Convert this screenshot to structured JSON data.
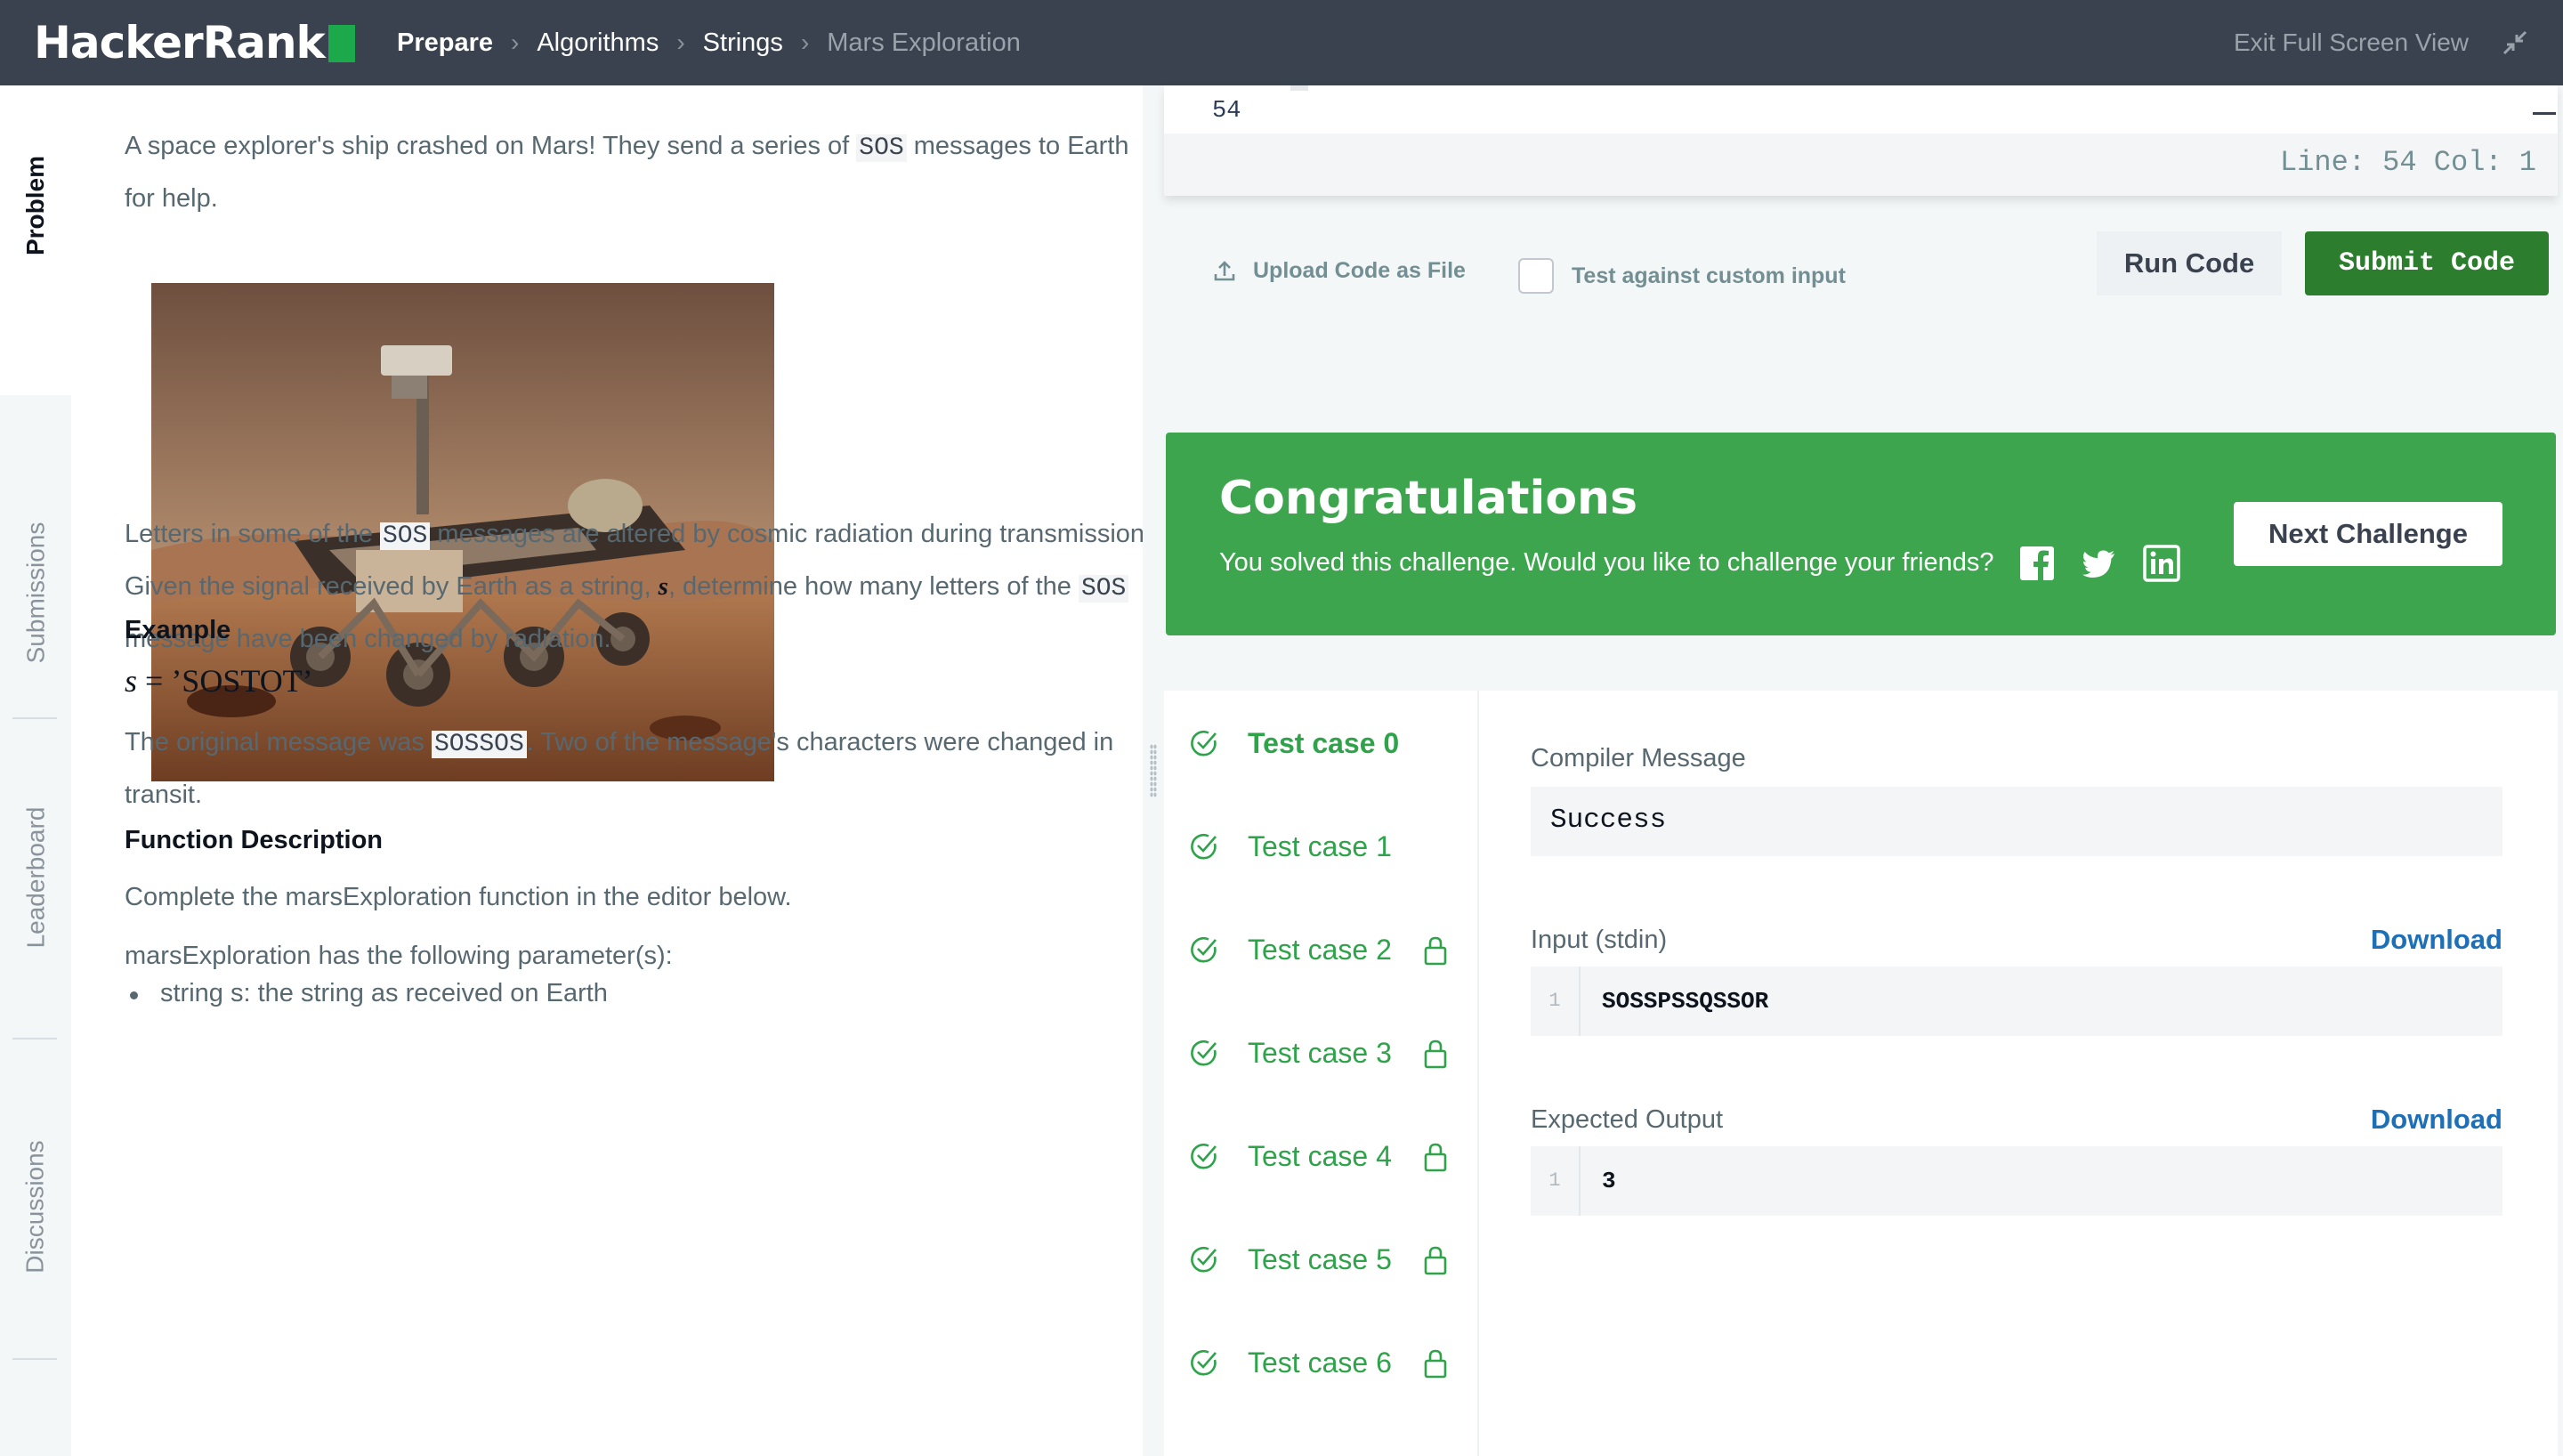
{
  "brand": {
    "name": "HackerRank",
    "accent": "#1ba94c"
  },
  "breadcrumbs": [
    "Prepare",
    "Algorithms",
    "Strings",
    "Mars Exploration"
  ],
  "header": {
    "exit_label": "Exit Full Screen View",
    "exit_icon": "shrink-arrows-icon"
  },
  "side_tabs": [
    {
      "label": "Problem",
      "active": true
    },
    {
      "label": "Submissions",
      "active": false
    },
    {
      "label": "Leaderboard",
      "active": false
    },
    {
      "label": "Discussions",
      "active": false
    }
  ],
  "problem": {
    "intro_before": "A space explorer's ship crashed on Mars! They send a series of ",
    "intro_code": "SOS",
    "intro_after": " messages to Earth for help.",
    "para2_before": "Letters in some of the ",
    "para2_code": "SOS",
    "para2_mid": " messages are altered by cosmic radiation during transmission. Given the signal received by Earth as a string, ",
    "para2_var": "s",
    "para2_mid2": ", determine how many letters of the ",
    "para2_code2": "SOS",
    "para2_after": " message have been changed by radiation.",
    "example_heading": "Example",
    "example_var": "s",
    "example_eq": " = ’SOSTOT’",
    "example_text_before": "The original message was ",
    "example_code": "SOSSOS",
    "example_text_after": ". Two of the message's characters were changed in transit.",
    "function_heading": "Function Description",
    "function_text": "Complete the marsExploration function in the editor below.",
    "params_text": "marsExploration has the following parameter(s):",
    "param_bullet": "string s: the string as received on Earth"
  },
  "editor": {
    "line_number": "54",
    "status": "Line: 54 Col: 1"
  },
  "actions": {
    "upload_label": "Upload Code as File",
    "custom_input_label": "Test against custom input",
    "custom_input_checked": false,
    "run_label": "Run Code",
    "submit_label": "Submit Code"
  },
  "congrats": {
    "title": "Congratulations",
    "subtitle": "You solved this challenge. Would you like to challenge your friends?",
    "social_icons": [
      "facebook-icon",
      "twitter-icon",
      "linkedin-icon"
    ],
    "next_label": "Next Challenge",
    "color": "#3da54e"
  },
  "test_cases": [
    {
      "label": "Test case 0",
      "locked": false,
      "active": true
    },
    {
      "label": "Test case 1",
      "locked": false,
      "active": false
    },
    {
      "label": "Test case 2",
      "locked": true,
      "active": false
    },
    {
      "label": "Test case 3",
      "locked": true,
      "active": false
    },
    {
      "label": "Test case 4",
      "locked": true,
      "active": false
    },
    {
      "label": "Test case 5",
      "locked": true,
      "active": false
    },
    {
      "label": "Test case 6",
      "locked": true,
      "active": false
    }
  ],
  "result": {
    "compiler_label": "Compiler Message",
    "compiler_value": "Success",
    "input_label": "Input (stdin)",
    "input_line": "1",
    "input_value": "SOSSPSSQSSOR",
    "output_label": "Expected Output",
    "output_line": "1",
    "output_value": "3",
    "download_label": "Download",
    "pass_color": "#2ea34a",
    "link_color": "#1d6fb8"
  }
}
